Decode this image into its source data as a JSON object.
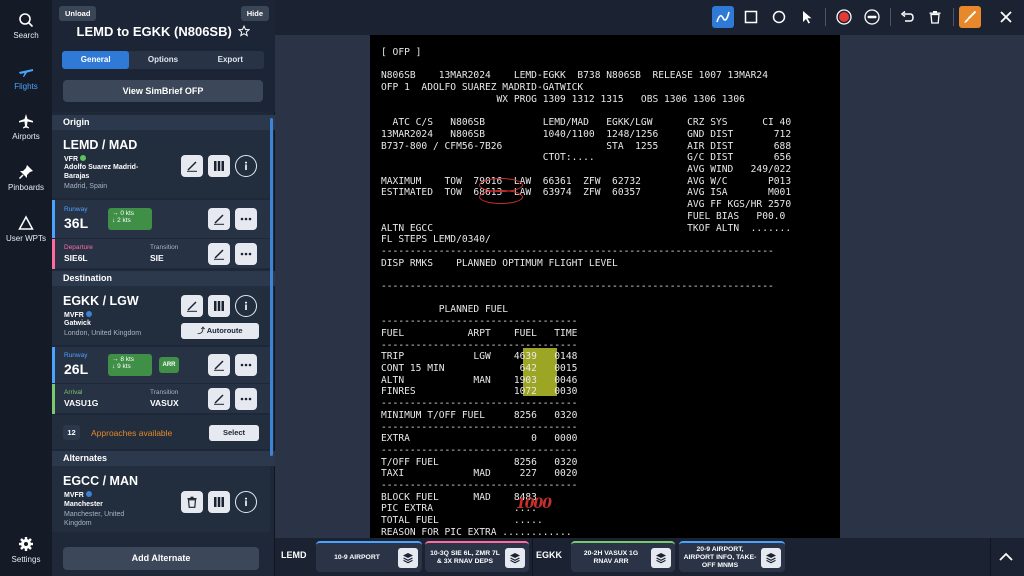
{
  "nav": {
    "search": "Search",
    "flights": "Flights",
    "airports": "Airports",
    "pinboards": "Pinboards",
    "user_wpts": "User WPTs",
    "settings": "Settings"
  },
  "panel": {
    "unload_label": "Unload",
    "hide_label": "Hide",
    "title": "LEMD to EGKK (N806SB)",
    "tabs": [
      "General",
      "Options",
      "Export"
    ],
    "active_tab": "General",
    "simbrief_label": "View SimBrief OFP",
    "origin_header": "Origin",
    "origin": {
      "airport": "LEMD / MAD",
      "flight_rules": "VFR",
      "name_line1": "Adolfo Suarez Madrid-",
      "name_line2": "Barajas",
      "location": "Madrid, Spain",
      "runway_label": "Runway",
      "runway": "36L",
      "wind_head": "0 kts",
      "wind_cross": "2 kts",
      "departure_label": "Departure",
      "departure": "SIE6L",
      "transition_label": "Transition",
      "transition": "SIE"
    },
    "destination_header": "Destination",
    "destination": {
      "airport": "EGKK / LGW",
      "flight_rules": "MVFR",
      "name": "Gatwick",
      "location": "London, United Kingdom",
      "autoroute_label": "Autoroute",
      "runway_label": "Runway",
      "runway": "26L",
      "wind_head": "8 kts",
      "wind_cross": "9 kts",
      "arr_badge": "ARR",
      "arrival_label": "Arrival",
      "arrival": "VASU1G",
      "transition_label": "Transition",
      "transition": "VASUX",
      "approaches_count": "12",
      "approaches_label": "Approaches available",
      "select_label": "Select"
    },
    "alternates_header": "Alternates",
    "alternate": {
      "airport": "EGCC / MAN",
      "flight_rules": "MVFR",
      "name": "Manchester",
      "location_line1": "Manchester, United",
      "location_line2": "Kingdom"
    },
    "add_alternate_label": "Add Alternate"
  },
  "toolbar": {
    "tools": [
      "line-tool-icon",
      "rectangle-tool-icon",
      "circle-tool-icon",
      "pointer-tool-icon",
      "record-icon",
      "minus-icon",
      "undo-icon",
      "trash-icon",
      "brush-icon",
      "close-icon"
    ],
    "accent": "#2f7ad6",
    "brush_color": "#e8882a"
  },
  "ofp": {
    "lines": [
      "[ OFP ]",
      "",
      "N806SB    13MAR2024    LEMD-EGKK  B738 N806SB  RELEASE 1007 13MAR24",
      "OFP 1  ADOLFO SUAREZ MADRID-GATWICK",
      "                    WX PROG 1309 1312 1315   OBS 1306 1306 1306",
      "",
      "  ATC C/S   N806SB          LEMD/MAD   EGKK/LGW      CRZ SYS      CI 40",
      "13MAR2024   N806SB          1040/1100  1248/1256     GND DIST       712",
      "B737-800 / CFM56-7B26                  STA  1255     AIR DIST       688",
      "                            CTOT:....                G/C DIST       656",
      "                                                     AVG WIND   249/022",
      "MAXIMUM    TOW  79016  LAW  66361  ZFW  62732        AVG W/C       P013",
      "ESTIMATED  TOW  68613  LAW  63974  ZFW  60357        AVG ISA       M001",
      "                                                     AVG FF KGS/HR 2570",
      "                                                     FUEL BIAS   P00.0",
      "ALTN EGCC                                            TKOF ALTN  .......",
      "FL STEPS LEMD/0340/",
      "--------------------------------------------------------------------",
      "DISP RMKS    PLANNED OPTIMUM FLIGHT LEVEL",
      "",
      "--------------------------------------------------------------------",
      "",
      "          PLANNED FUEL",
      "----------------------------------",
      "FUEL           ARPT    FUEL   TIME",
      "----------------------------------",
      "TRIP            LGW    4639   0148",
      "CONT 15 MIN             642   0015",
      "ALTN            MAN    1903   0046",
      "FINRES                 1072   0030",
      "----------------------------------",
      "MINIMUM T/OFF FUEL     8256   0320",
      "----------------------------------",
      "EXTRA                     0   0000",
      "----------------------------------",
      "T/OFF FUEL             8256   0320",
      "TAXI            MAD     227   0020",
      "----------------------------------",
      "BLOCK FUEL      MAD    8483",
      "PIC EXTRA              ....",
      "TOTAL FUEL             .....",
      "REASON FOR PIC EXTRA ............"
    ],
    "annotation_text": "1000"
  },
  "bottom": {
    "origin_tag": "LEMD",
    "dest_tag": "EGKK",
    "charts": [
      {
        "label": "10-9 AIRPORT",
        "color": "#4aa3ff"
      },
      {
        "label": "10-3Q SIE 6L, ZMR 7L & 3X RNAV DEPS",
        "color": "#ff6b9d"
      },
      {
        "label": "20-2H VASUX 1G RNAV ARR",
        "color": "#7bc96f"
      },
      {
        "label": "20-9 AIRPORT, AIRPORT INFO, TAKE-OFF MNMS",
        "color": "#4aa3ff"
      }
    ]
  }
}
